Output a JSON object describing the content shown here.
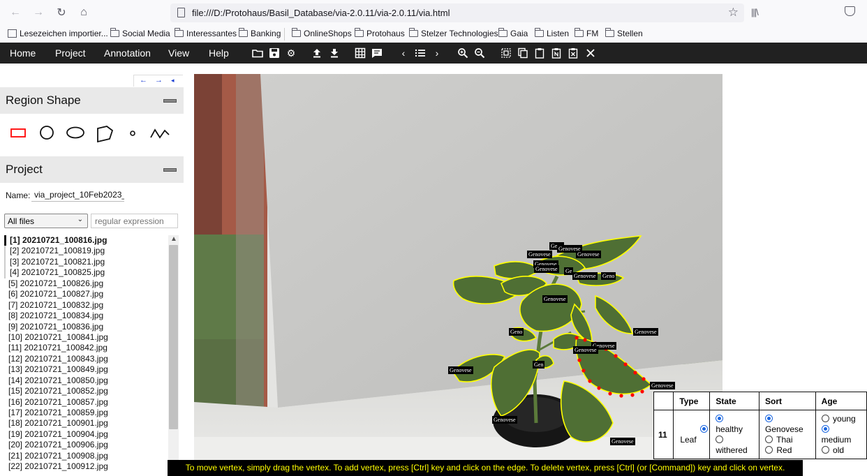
{
  "browser": {
    "url": "file:///D:/Protohaus/Basil_Database/via-2.0.11/via-2.0.11/via.html",
    "library_label": "|||\\",
    "bookmarks": [
      {
        "label": "Lesezeichen importier...",
        "icon": "import-icon"
      },
      {
        "label": "Social Media",
        "icon": "folder-icon"
      },
      {
        "label": "Interessantes",
        "icon": "folder-icon"
      },
      {
        "label": "Banking",
        "icon": "folder-icon"
      },
      {
        "label": "OnlineShops",
        "icon": "folder-icon"
      },
      {
        "label": "Protohaus",
        "icon": "folder-icon"
      },
      {
        "label": "Stelzer Technologies",
        "icon": "folder-icon"
      },
      {
        "label": "Gaia",
        "icon": "folder-icon"
      },
      {
        "label": "Listen",
        "icon": "folder-icon"
      },
      {
        "label": "FM",
        "icon": "folder-icon"
      },
      {
        "label": "Stellen",
        "icon": "folder-icon"
      }
    ]
  },
  "menu": {
    "items": [
      "Home",
      "Project",
      "Annotation",
      "View",
      "Help"
    ]
  },
  "leftnav": {
    "prev": "←",
    "next": "→",
    "collapse": "◂"
  },
  "region_shape": {
    "title": "Region Shape",
    "active_color": "#ff0000"
  },
  "project": {
    "title": "Project",
    "name_label": "Name:",
    "name_value": "via_project_10Feb2023_",
    "filter_selected": "All files",
    "filter_placeholder": "regular expression",
    "files": [
      "[1] 20210721_100816.jpg",
      "[2] 20210721_100819.jpg",
      "[3] 20210721_100821.jpg",
      "[4] 20210721_100825.jpg",
      "[5] 20210721_100826.jpg",
      "[6] 20210721_100827.jpg",
      "[7] 20210721_100832.jpg",
      "[8] 20210721_100834.jpg",
      "[9] 20210721_100836.jpg",
      "[10] 20210721_100841.jpg",
      "[11] 20210721_100842.jpg",
      "[12] 20210721_100843.jpg",
      "[13] 20210721_100849.jpg",
      "[14] 20210721_100850.jpg",
      "[15] 20210721_100852.jpg",
      "[16] 20210721_100857.jpg",
      "[17] 20210721_100859.jpg",
      "[18] 20210721_100901.jpg",
      "[19] 20210721_100904.jpg",
      "[20] 20210721_100906.jpg",
      "[21] 20210721_100908.jpg",
      "[22] 20210721_100912.jpg"
    ]
  },
  "canvas": {
    "region_labels": [
      "Geno",
      "Genovese",
      "Genovese",
      "Genovese",
      "Genovese",
      "Ge",
      "Genovese",
      "Geno",
      "Genovese",
      "Genovese",
      "Genovese",
      "Genovese",
      "Genovese",
      "Geno",
      "Gen",
      "Genovese",
      "Genovese",
      "Genovese",
      "Genovese"
    ],
    "region_color": "#ffff00",
    "selected_color": "#ff0000"
  },
  "attributes": {
    "headers": [
      "",
      "Type",
      "State",
      "Sort",
      "Age"
    ],
    "region_id": "11",
    "type": {
      "options": [
        "Leaf"
      ],
      "selected": "Leaf"
    },
    "state": {
      "options": [
        "healthy",
        "withered"
      ],
      "selected": "healthy"
    },
    "sort": {
      "options": [
        "Genovese",
        "Thai",
        "Red"
      ],
      "selected": "Genovese"
    },
    "age": {
      "options": [
        "young",
        "medium",
        "old"
      ],
      "selected": "medium"
    }
  },
  "message": "To move vertex, simply drag the vertex. To add vertex, press [Ctrl] key and click on the edge. To delete vertex, press [Ctrl] (or [Command]) key and click on vertex."
}
